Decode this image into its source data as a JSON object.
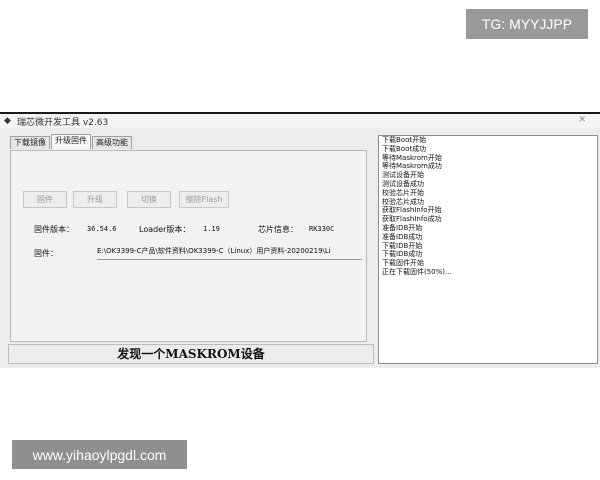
{
  "watermarks": {
    "top": "TG: MYYJJPP",
    "bottom": "www.yihaoylpgdl.com"
  },
  "window": {
    "title": "瑞芯微开发工具 v2.63"
  },
  "tabs": [
    "下载镜像",
    "升级固件",
    "高级功能"
  ],
  "active_tab": "升级固件",
  "buttons": {
    "firmware": "固件",
    "upgrade": "升级",
    "switch": "切换",
    "erase_flash": "擦除Flash"
  },
  "firmware_info": {
    "version_label": "固件版本：",
    "version_value": "36.54.6",
    "loader_label": "Loader版本：",
    "loader_value": "1.19",
    "chip_label": "芯片信息：",
    "chip_value": "RK330C",
    "path_label": "固件：",
    "path_value": "E:\\OK3399-C产品\\软件资料\\OK3399-C（Linux）用户资料-20200219\\Li"
  },
  "status_message": "发现一个MASKROM设备",
  "log_lines": [
    "下载Boot开始",
    "下载Boot成功",
    "等待Maskrom开始",
    "等待Maskrom成功",
    "测试设备开始",
    "测试设备成功",
    "校验芯片开始",
    "校验芯片成功",
    "获取FlashInfo开始",
    "获取FlashInfo成功",
    "准备IDB开始",
    "准备IDB成功",
    "下载IDB开始",
    "下载IDB成功",
    "下载固件开始",
    "正在下载固件(50%)..."
  ]
}
